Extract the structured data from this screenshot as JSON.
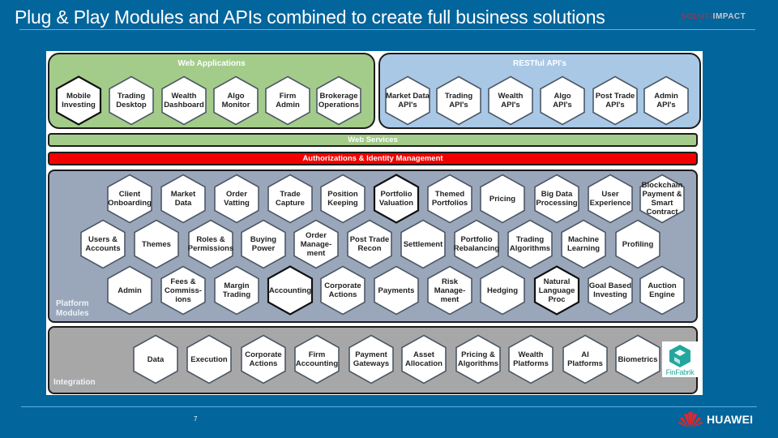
{
  "slide": {
    "title": "Plug & Play Modules and APIs combined to create full business solutions",
    "overlap_logo": {
      "part_a": "SOLUTI",
      "part_b": "IMPACT"
    },
    "page_number": "7",
    "brand": "HUAWEI",
    "colors": {
      "background": "#02659c",
      "web_green": "#a3cc8a",
      "api_blue": "#a8c8e6",
      "auth_red": "#f20000",
      "platform_gray_blue": "#9aa7bb",
      "integration_gray": "#a8a7a7"
    }
  },
  "diagram": {
    "web_applications": {
      "title": "Web Applications",
      "items": [
        {
          "label": "Mobile\nInvesting",
          "highlight": true
        },
        {
          "label": "Trading\nDesktop",
          "highlight": false
        },
        {
          "label": "Wealth\nDashboard",
          "highlight": false
        },
        {
          "label": "Algo\nMonitor",
          "highlight": false
        },
        {
          "label": "Firm\nAdmin",
          "highlight": false
        },
        {
          "label": "Brokerage\nOperations",
          "highlight": false
        }
      ]
    },
    "restful_apis": {
      "title": "RESTful API's",
      "items": [
        {
          "label": "Market Data\nAPI's",
          "highlight": false
        },
        {
          "label": "Trading\nAPI's",
          "highlight": false
        },
        {
          "label": "Wealth\nAPI's",
          "highlight": false
        },
        {
          "label": "Algo\nAPI's",
          "highlight": false
        },
        {
          "label": "Post Trade\nAPI's",
          "highlight": false
        },
        {
          "label": "Admin\nAPI's",
          "highlight": false
        }
      ]
    },
    "web_services": {
      "title": "Web Services"
    },
    "auth": {
      "title": "Authorizations & Identity Management"
    },
    "platform_modules": {
      "title": "Platform\nModules",
      "rows": [
        [
          {
            "label": "Client\nOnboarding",
            "highlight": false
          },
          {
            "label": "Market\nData",
            "highlight": false
          },
          {
            "label": "Order\nVatting",
            "highlight": false
          },
          {
            "label": "Trade\nCapture",
            "highlight": false
          },
          {
            "label": "Position\nKeeping",
            "highlight": false
          },
          {
            "label": "Portfolio\nValuation",
            "highlight": true
          },
          {
            "label": "Themed\nPortfolios",
            "highlight": false
          },
          {
            "label": "Pricing",
            "highlight": false
          },
          {
            "label": "Big Data\nProcessing",
            "highlight": false
          },
          {
            "label": "User\nExperience",
            "highlight": false
          },
          {
            "label": "Blockchain\nPayment &\nSmart\nContract",
            "highlight": false
          }
        ],
        [
          {
            "label": "Users &\nAccounts",
            "highlight": false
          },
          {
            "label": "Themes",
            "highlight": false
          },
          {
            "label": "Roles &\nPermissions",
            "highlight": false
          },
          {
            "label": "Buying\nPower",
            "highlight": false
          },
          {
            "label": "Order\nManage-\nment",
            "highlight": false
          },
          {
            "label": "Post Trade\nRecon",
            "highlight": false
          },
          {
            "label": "Settlement",
            "highlight": false
          },
          {
            "label": "Portfolio\nRebalancing",
            "highlight": false
          },
          {
            "label": "Trading\nAlgorithms",
            "highlight": false
          },
          {
            "label": "Machine\nLearning",
            "highlight": false
          },
          {
            "label": "Profiling",
            "highlight": false
          }
        ],
        [
          {
            "label": "Admin",
            "highlight": false
          },
          {
            "label": "Fees &\nCommiss-\nions",
            "highlight": false
          },
          {
            "label": "Margin\nTrading",
            "highlight": false
          },
          {
            "label": "Accounting",
            "highlight": true
          },
          {
            "label": "Corporate\nActions",
            "highlight": false
          },
          {
            "label": "Payments",
            "highlight": false
          },
          {
            "label": "Risk\nManage-\nment",
            "highlight": false
          },
          {
            "label": "Hedging",
            "highlight": false
          },
          {
            "label": "Natural\nLanguage\nProc",
            "highlight": true
          },
          {
            "label": "Goal Based\nInvesting",
            "highlight": false
          },
          {
            "label": "Auction\nEngine",
            "highlight": false
          }
        ]
      ]
    },
    "integration": {
      "title": "Integration",
      "items": [
        {
          "label": "Data",
          "highlight": false
        },
        {
          "label": "Execution",
          "highlight": false
        },
        {
          "label": "Corporate\nActions",
          "highlight": false
        },
        {
          "label": "Firm\nAccounting",
          "highlight": false
        },
        {
          "label": "Payment\nGateways",
          "highlight": false
        },
        {
          "label": "Asset\nAllocation",
          "highlight": false
        },
        {
          "label": "Pricing &\nAlgorithms",
          "highlight": false
        },
        {
          "label": "Wealth\nPlatforms",
          "highlight": false
        },
        {
          "label": "AI\nPlatforms",
          "highlight": false
        },
        {
          "label": "Biometrics",
          "highlight": false
        }
      ],
      "partner_logo": {
        "name": "FinFabrik",
        "icon": "finfabrik-cube-icon"
      }
    }
  }
}
